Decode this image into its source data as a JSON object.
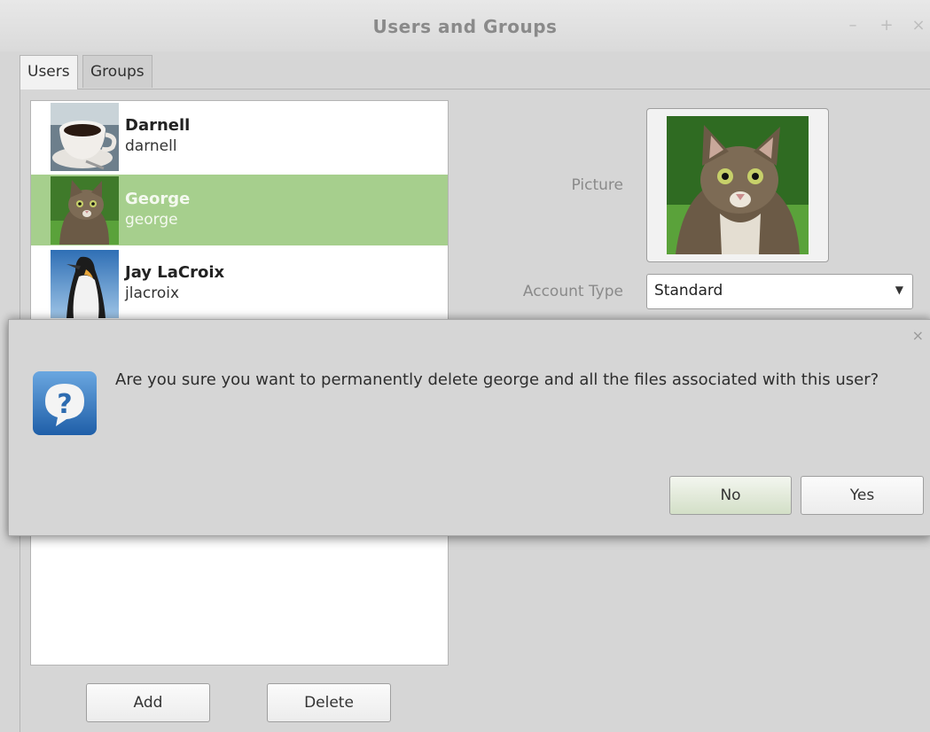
{
  "window": {
    "title": "Users and Groups",
    "controls": {
      "minimize": "–",
      "maximize": "+",
      "close": "×"
    }
  },
  "tabs": [
    {
      "label": "Users",
      "active": true
    },
    {
      "label": "Groups",
      "active": false
    }
  ],
  "users": [
    {
      "name": "Darnell",
      "login": "darnell",
      "avatar": "coffee-cup-image",
      "selected": false
    },
    {
      "name": "George",
      "login": "george",
      "avatar": "kitten-image",
      "selected": true
    },
    {
      "name": "Jay LaCroix",
      "login": "jlacroix",
      "avatar": "penguin-image",
      "selected": false
    }
  ],
  "details": {
    "picture_label": "Picture",
    "account_type_label": "Account Type",
    "account_type_value": "Standard"
  },
  "actions": {
    "add_label": "Add",
    "delete_label": "Delete"
  },
  "dialog": {
    "close": "×",
    "message": "Are you sure you want to permanently delete george and all the files associated with this user?",
    "icon": "question-icon",
    "no_label": "No",
    "yes_label": "Yes"
  },
  "colors": {
    "selection": "#a6cf8d",
    "background": "#d6d6d6"
  }
}
